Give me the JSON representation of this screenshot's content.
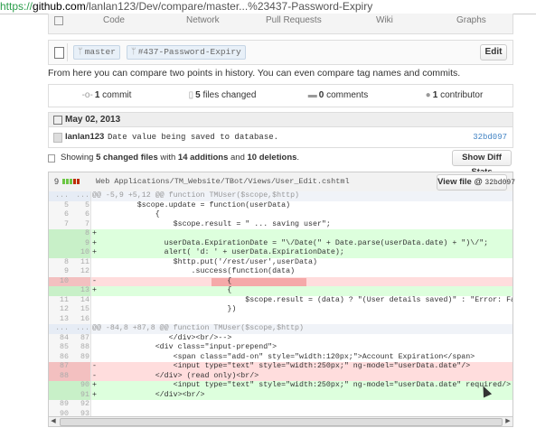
{
  "browser": {
    "scheme": "https://",
    "host": "github.com",
    "path": "/lanlan123/Dev/compare/master...%23437-Password-Expiry"
  },
  "repo_tabs": [
    "Code",
    "Network",
    "Pull Requests",
    "Wiki",
    "Graphs"
  ],
  "compare": {
    "base": "master",
    "head": "#437-Password-Expiry",
    "separator": "...",
    "edit_label": "Edit"
  },
  "intro": "From here you can compare two points in history. You can even compare tag names and commits.",
  "stats": {
    "commits": {
      "count": "1",
      "label": "commit"
    },
    "files": {
      "count": "5",
      "label": "files changed"
    },
    "comments": {
      "count": "0",
      "label": "comments"
    },
    "contributors": {
      "count": "1",
      "label": "contributor"
    }
  },
  "commit_group": {
    "date": "May 02, 2013",
    "commit": {
      "author": "lanlan123",
      "message": "Date value being saved to database.",
      "sha": "32bd097"
    }
  },
  "summary": {
    "prefix": "Showing",
    "files": "5 changed files",
    "mid": "with",
    "additions": "14 additions",
    "and": "and",
    "deletions": "10 deletions",
    "end": ".",
    "diff_stats_label": "Show Diff Stats"
  },
  "file": {
    "changes": "9",
    "bar_colors": [
      "#6cc644",
      "#6cc644",
      "#6cc644",
      "#bd2c00",
      "#bd2c00"
    ],
    "path": "Web Applications/TM_Website/TBot/Views/User_Edit.cshtml",
    "view_label": "View file @",
    "view_sha": "32bd097"
  },
  "diff": [
    {
      "type": "hunk",
      "old": "...",
      "new": "...",
      "text": "@@ -5,9 +5,12 @@ function TMUser($scope,$http)"
    },
    {
      "type": "ctx",
      "old": "5",
      "new": "5",
      "text": "          $scope.update = function(userData)"
    },
    {
      "type": "ctx",
      "old": "6",
      "new": "6",
      "text": "              {"
    },
    {
      "type": "ctx",
      "old": "7",
      "new": "7",
      "text": "                  $scope.result = \" ... saving user\";"
    },
    {
      "type": "add",
      "old": "",
      "new": "8",
      "text": "+"
    },
    {
      "type": "add",
      "old": "",
      "new": "9",
      "text": "+               userData.ExpirationDate = \"\\/Date(\" + Date.parse(userData.date) + \")\\/\";"
    },
    {
      "type": "add",
      "old": "",
      "new": "10",
      "text": "+               alert( 'd: ' + userData.ExpirationDate);"
    },
    {
      "type": "ctx",
      "old": "8",
      "new": "11",
      "text": "                  $http.put('/rest/user',userData)"
    },
    {
      "type": "ctx",
      "old": "9",
      "new": "12",
      "text": "                      .success(function(data)"
    },
    {
      "type": "del",
      "old": "10",
      "new": "",
      "text": "-                             {"
    },
    {
      "type": "add",
      "old": "",
      "new": "13",
      "text": "+                             {"
    },
    {
      "type": "ctx",
      "old": "11",
      "new": "14",
      "text": "                                  $scope.result = (data) ? \"(User details saved)\" : \"Error: Failed to Save user"
    },
    {
      "type": "ctx",
      "old": "12",
      "new": "15",
      "text": "                              })"
    },
    {
      "type": "ctx",
      "old": "13",
      "new": "16",
      "text": ""
    },
    {
      "type": "hunk",
      "old": "...",
      "new": "...",
      "text": "@@ -84,8 +87,8 @@ function TMUser($scope,$http)"
    },
    {
      "type": "ctx",
      "old": "84",
      "new": "87",
      "text": "                 </div><br/>-->"
    },
    {
      "type": "ctx",
      "old": "85",
      "new": "88",
      "text": "              <div class=\"input-prepend\">"
    },
    {
      "type": "ctx",
      "old": "86",
      "new": "89",
      "text": "                  <span class=\"add-on\" style=\"width:120px;\">Account Expiration</span>"
    },
    {
      "type": "del",
      "old": "87",
      "new": "",
      "text": "-                 <input type=\"text\" style=\"width:250px;\" ng-model=\"userData.date\"/>"
    },
    {
      "type": "del",
      "old": "88",
      "new": "",
      "text": "-             </div> (read only)<br/>"
    },
    {
      "type": "add",
      "old": "",
      "new": "90",
      "text": "+                 <input type=\"text\" style=\"width:250px;\" ng-model=\"userData.date\" required/>"
    },
    {
      "type": "add",
      "old": "",
      "new": "91",
      "text": "+             </div><br/>"
    },
    {
      "type": "ctx",
      "old": "89",
      "new": "92",
      "text": ""
    },
    {
      "type": "ctx",
      "old": "90",
      "new": "93",
      "text": ""
    },
    {
      "type": "ctx",
      "old": "91",
      "new": "94",
      "text": "              <label class=\"checkbox\">"
    }
  ]
}
